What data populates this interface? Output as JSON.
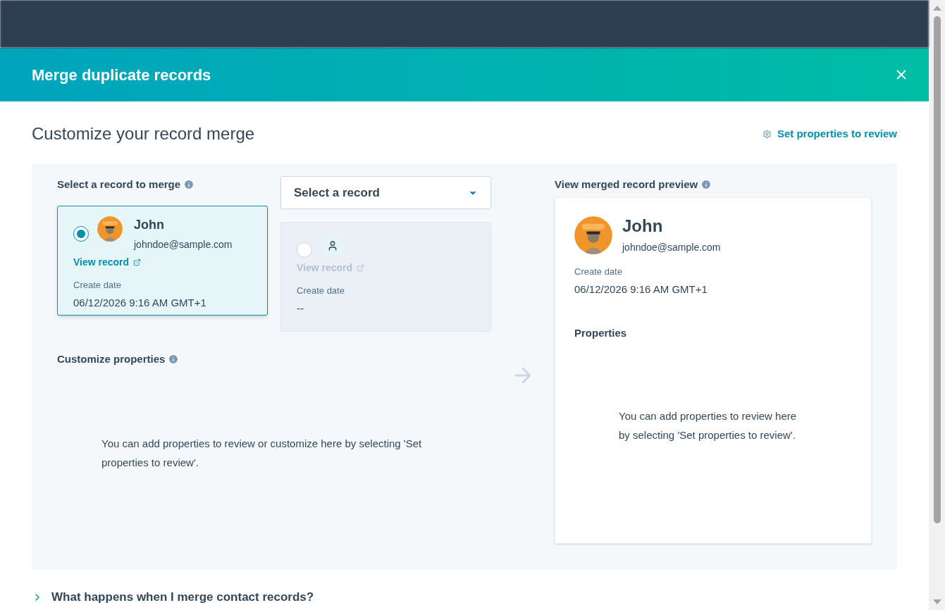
{
  "modal": {
    "title": "Merge duplicate records"
  },
  "heading": "Customize your record merge",
  "settings_link": "Set properties to review",
  "select_label": "Select a record to merge",
  "record_dropdown": {
    "placeholder": "Select a record"
  },
  "records": [
    {
      "selected": true,
      "kind": "contact",
      "name": "John",
      "email": "johndoe@sample.com",
      "link": "View record",
      "disabled": false,
      "date_label": "Create date",
      "date": "06/12/2026 9:16 AM GMT+1"
    },
    {
      "selected": false,
      "kind": "empty",
      "link": "View record",
      "disabled": true,
      "date_label": "Create date",
      "date": "--"
    }
  ],
  "customize": {
    "label": "Customize properties",
    "empty_text": "You can add properties to review or customize here by selecting 'Set properties to review'."
  },
  "preview": {
    "label": "View merged record preview",
    "name": "John",
    "email": "johndoe@sample.com",
    "date_label": "Create date",
    "date": "06/12/2026 9:16 AM GMT+1",
    "properties_label": "Properties",
    "empty_text": "You can add properties to review here by selecting 'Set properties to review'."
  },
  "faq": {
    "label": "What happens when I merge contact records?",
    "expanded": false
  }
}
